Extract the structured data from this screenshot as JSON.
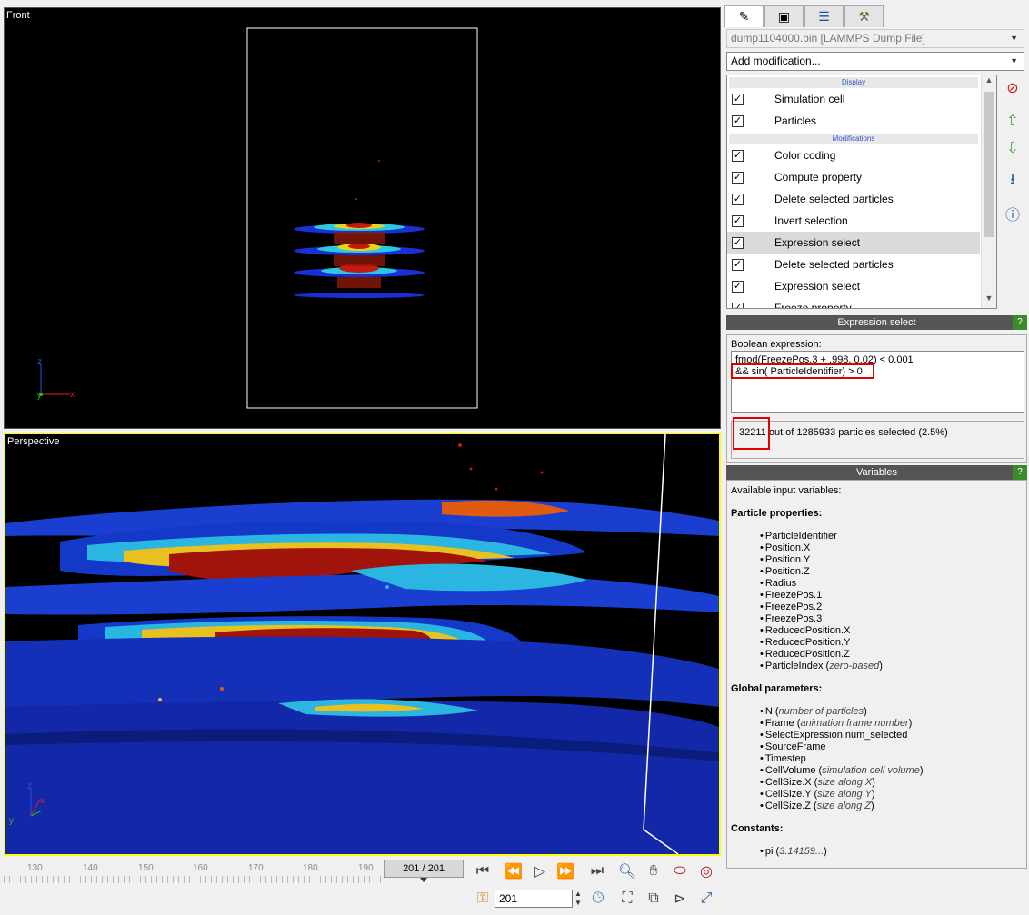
{
  "viewports": {
    "front_title": "Front",
    "perspective_title": "Perspective"
  },
  "axes": {
    "x": "x",
    "y": "y",
    "z": "z"
  },
  "timeline": {
    "ticks": [
      "130",
      "140",
      "150",
      "160",
      "170",
      "180",
      "190"
    ],
    "frame_display": "201 / 201",
    "spinner_value": "201"
  },
  "toolbar_icons": [
    "goto-start-icon",
    "step-back-icon",
    "play-icon",
    "step-forward-icon",
    "goto-end-icon",
    "zoom-icon",
    "pan-icon",
    "orbit-icon",
    "pick-orbit-center-icon",
    "animation-settings-key-icon",
    "animation-settings-icon",
    "maximize-viewport-icon",
    "zoom-all-icon",
    "fov-icon",
    "zoom-scene-extents-icon"
  ],
  "panel": {
    "tabs": [
      "pencil-icon",
      "render-icon",
      "layers-icon",
      "utilities-icon"
    ],
    "file_combo": "dump1104000.bin [LAMMPS Dump File]",
    "add_modification": "Add modification...",
    "pipeline": {
      "display_header": "Display",
      "display_items": [
        "Simulation cell",
        "Particles"
      ],
      "modifications_header": "Modifications",
      "modification_items": [
        "Color coding",
        "Compute property",
        "Delete selected particles",
        "Invert selection",
        "Expression select",
        "Delete selected particles",
        "Expression select",
        "Freeze property"
      ],
      "selected_index": 4
    },
    "expression_select": {
      "title": "Expression select",
      "help": "?",
      "label": "Boolean expression:",
      "line1": "fmod(FreezePos.3 + .998, 0.02) < 0.001",
      "line2": "&& sin( ParticleIdentifier) > 0",
      "status_count": "32211",
      "status_rest": " out of 1285933 particles selected (2.5%)"
    },
    "variables": {
      "title": "Variables",
      "help": "?",
      "intro": "Available input variables:",
      "particle_properties_title": "Particle properties:",
      "particle_properties": [
        {
          "name": "ParticleIdentifier",
          "note": ""
        },
        {
          "name": "Position.X",
          "note": ""
        },
        {
          "name": "Position.Y",
          "note": ""
        },
        {
          "name": "Position.Z",
          "note": ""
        },
        {
          "name": "Radius",
          "note": ""
        },
        {
          "name": "FreezePos.1",
          "note": ""
        },
        {
          "name": "FreezePos.2",
          "note": ""
        },
        {
          "name": "FreezePos.3",
          "note": ""
        },
        {
          "name": "ReducedPosition.X",
          "note": ""
        },
        {
          "name": "ReducedPosition.Y",
          "note": ""
        },
        {
          "name": "ReducedPosition.Z",
          "note": ""
        },
        {
          "name": "ParticleIndex",
          "note": "zero-based"
        }
      ],
      "global_parameters_title": "Global parameters:",
      "global_parameters": [
        {
          "name": "N",
          "note": "number of particles"
        },
        {
          "name": "Frame",
          "note": "animation frame number"
        },
        {
          "name": "SelectExpression.num_selected",
          "note": ""
        },
        {
          "name": "SourceFrame",
          "note": ""
        },
        {
          "name": "Timestep",
          "note": ""
        },
        {
          "name": "CellVolume",
          "note": "simulation cell volume"
        },
        {
          "name": "CellSize.X",
          "note": "size along X"
        },
        {
          "name": "CellSize.Y",
          "note": "size along Y"
        },
        {
          "name": "CellSize.Z",
          "note": "size along Z"
        }
      ],
      "constants_title": "Constants:",
      "constants": [
        {
          "name": "pi",
          "note": "3.14159..."
        }
      ]
    }
  },
  "colors": {
    "viewport_bg": "#000000",
    "active_viewport_border": "#ffff00",
    "highlight_red": "#e00000",
    "section_bar": "#555555"
  }
}
